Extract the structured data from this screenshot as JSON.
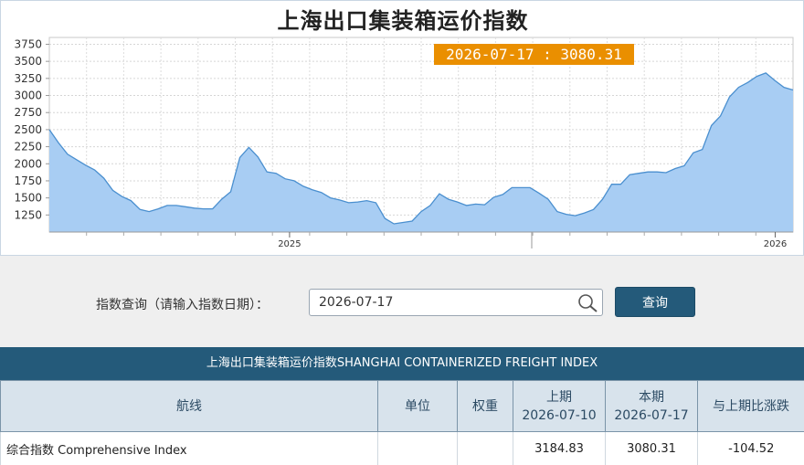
{
  "chart": {
    "title": "上海出口集装箱运价指数",
    "tooltip": "2026-07-17 : 3080.31",
    "colors": {
      "fill": "#a8cdf3",
      "line": "#4a8fcf",
      "tooltip_bg": "#ea8f00"
    }
  },
  "chart_data": {
    "type": "area",
    "yticks": [
      1250,
      1500,
      1750,
      2000,
      2250,
      2500,
      2750,
      3000,
      3250,
      3500,
      3750
    ],
    "ylim": [
      1000,
      3850
    ],
    "xticks": [
      "2025",
      "2026"
    ],
    "grid": true,
    "legend": "none",
    "series": [
      {
        "values": [
          2500,
          2310,
          2140,
          2060,
          1980,
          1910,
          1790,
          1610,
          1520,
          1460,
          1330,
          1300,
          1340,
          1390,
          1390,
          1370,
          1350,
          1340,
          1340,
          1480,
          1590,
          2090,
          2240,
          2100,
          1880,
          1860,
          1780,
          1750,
          1670,
          1620,
          1580,
          1500,
          1470,
          1430,
          1440,
          1460,
          1430,
          1200,
          1120,
          1140,
          1160,
          1300,
          1390,
          1560,
          1480,
          1440,
          1390,
          1410,
          1400,
          1510,
          1550,
          1650,
          1650,
          1650,
          1570,
          1480,
          1300,
          1260,
          1240,
          1280,
          1330,
          1480,
          1700,
          1700,
          1840,
          1860,
          1880,
          1880,
          1870,
          1930,
          1970,
          2160,
          2210,
          2560,
          2700,
          2980,
          3120,
          3190,
          3280,
          3330,
          3220,
          3120,
          3080.31
        ]
      }
    ]
  },
  "query": {
    "label": "指数查询（请输入指数日期）：",
    "date_value": "2026-07-17",
    "button_label": "查询"
  },
  "table": {
    "title": "上海出口集装箱运价指数SHANGHAI CONTAINERIZED FREIGHT INDEX",
    "headers": {
      "route": "航线",
      "unit": "单位",
      "weight": "权重",
      "prev_label": "上期",
      "prev_date": "2026-07-10",
      "curr_label": "本期",
      "curr_date": "2026-07-17",
      "change": "与上期比涨跌"
    },
    "rows": [
      {
        "route": "综合指数 Comprehensive Index",
        "unit": "",
        "weight": "",
        "prev": "3184.83",
        "curr": "3080.31",
        "change": "-104.52"
      }
    ]
  }
}
